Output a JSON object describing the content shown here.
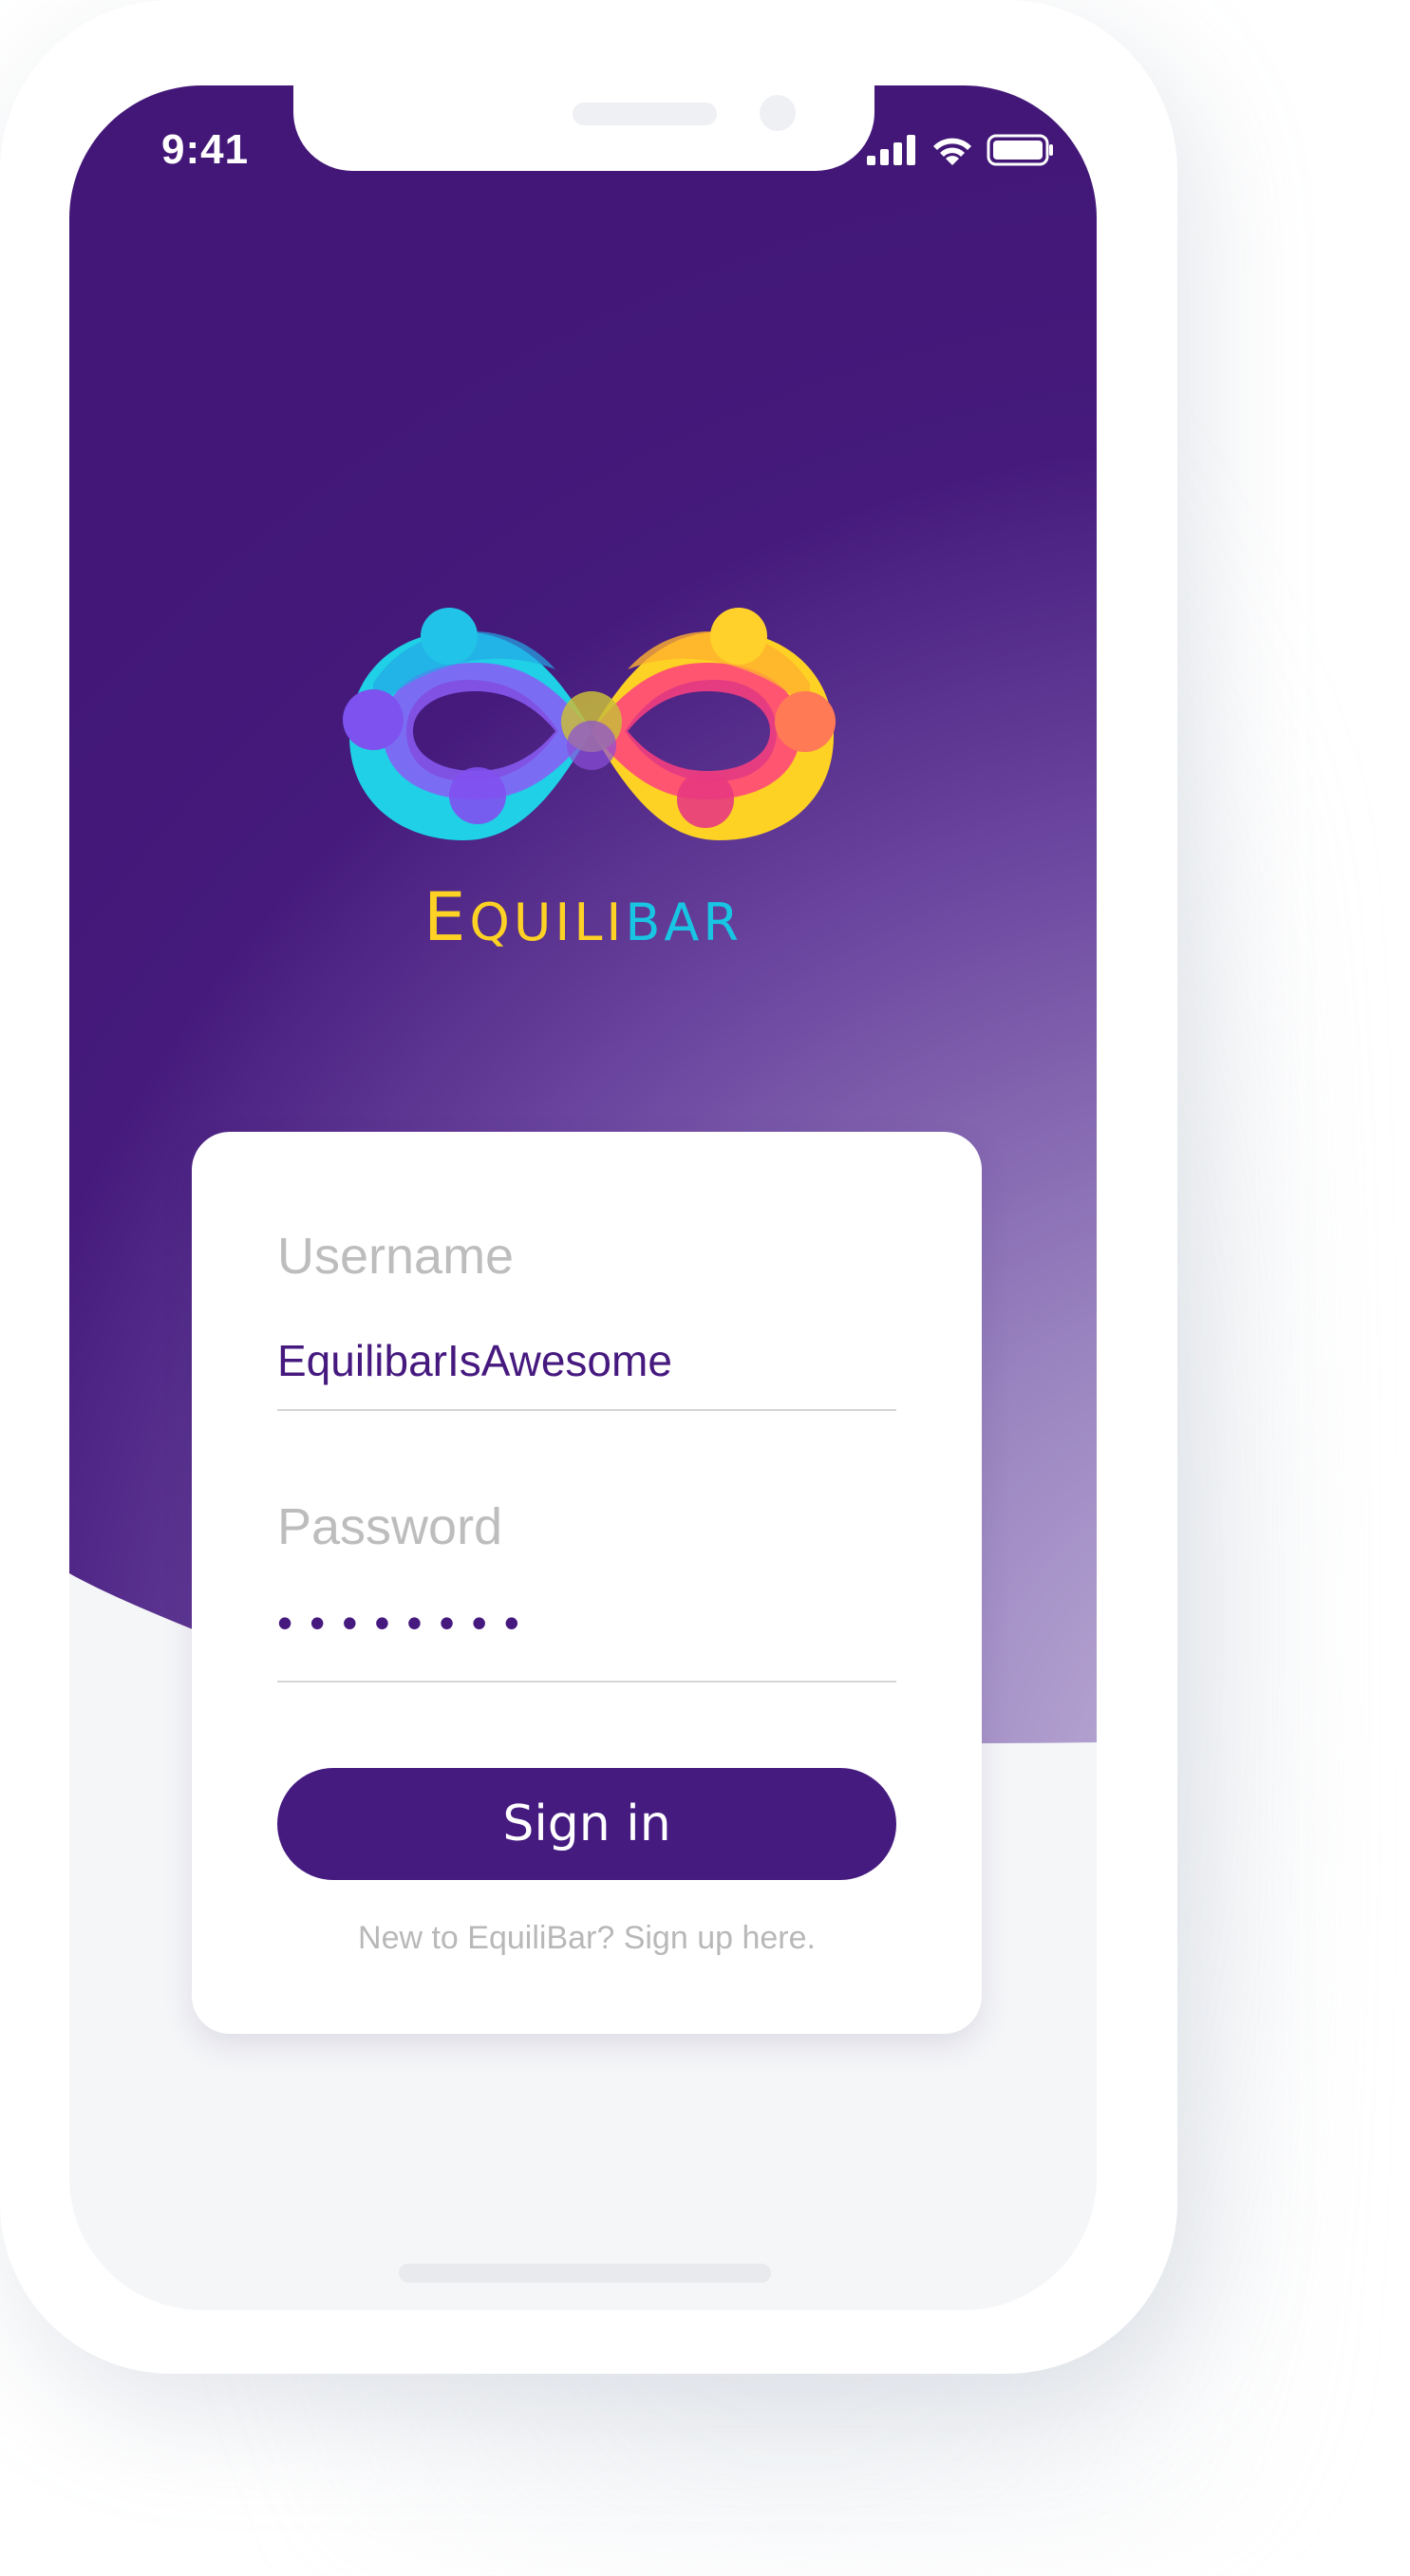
{
  "status_bar": {
    "time": "9:41",
    "icons": [
      "cellular-signal-icon",
      "wifi-icon",
      "battery-icon"
    ]
  },
  "brand": {
    "name_part1_cap": "E",
    "name_part1_rest": "QUILI",
    "name_part2": "BAR",
    "colors": {
      "yellow": "#fdd224",
      "cyan": "#18c6e4"
    }
  },
  "login": {
    "username_label": "Username",
    "username_value": "EquilibarIsAwesome",
    "password_label": "Password",
    "password_value": "••••••••",
    "signin_label": "Sign in",
    "signup_text": "New to EquiliBar? Sign up here."
  },
  "theme": {
    "primary": "#451b80",
    "hero_start": "#421777",
    "hero_end": "#a48cc4",
    "screen_bg": "#f5f6f8"
  }
}
